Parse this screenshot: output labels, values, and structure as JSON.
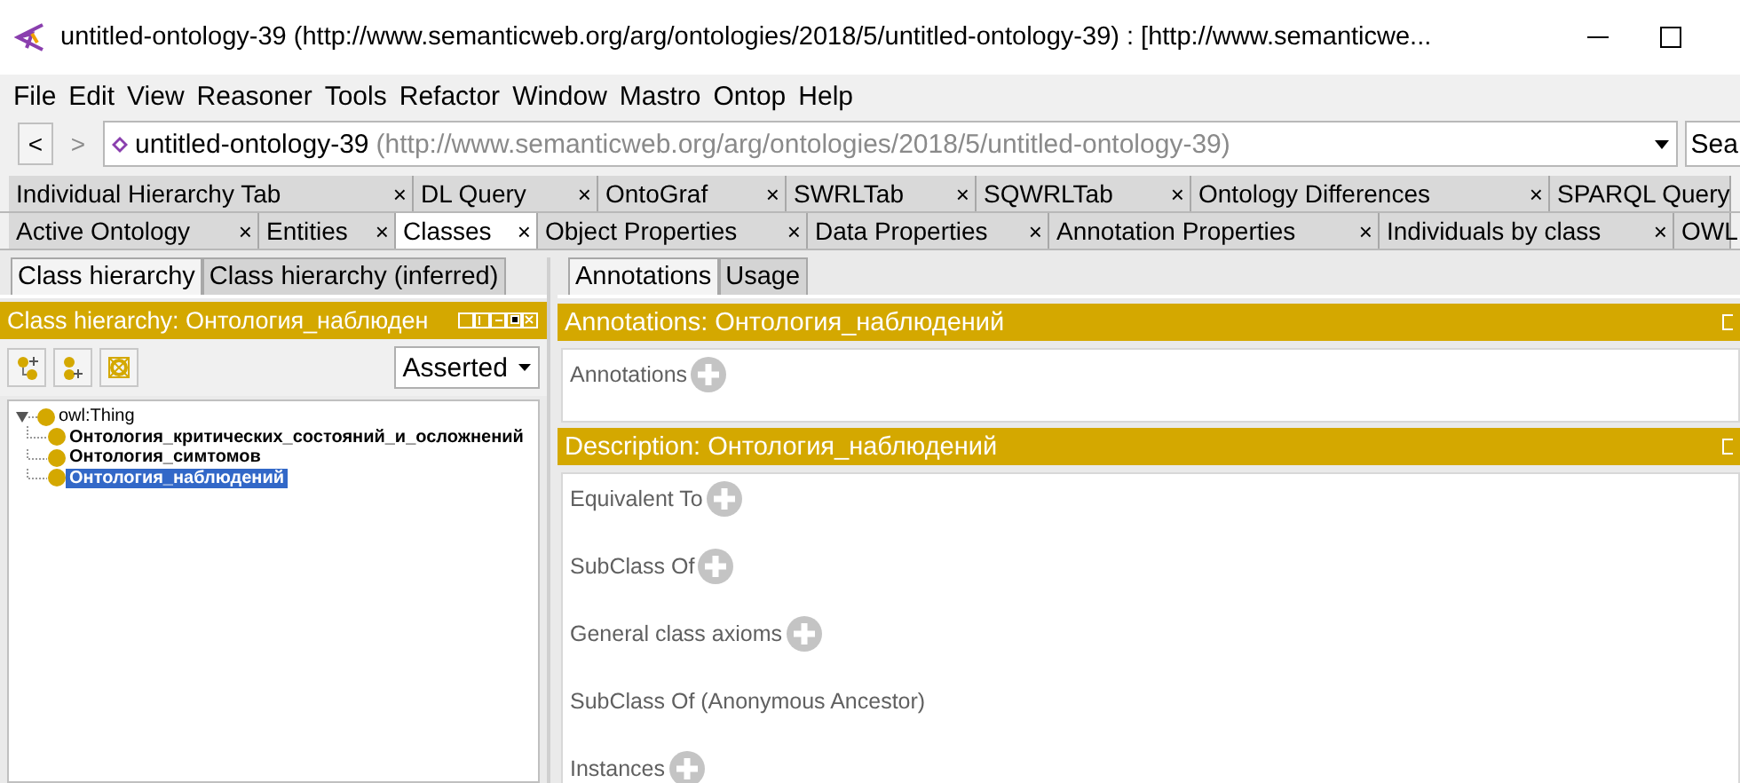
{
  "window": {
    "title": "untitled-ontology-39 (http://www.semanticweb.org/arg/ontologies/2018/5/untitled-ontology-39)  : [http://www.semanticwe..."
  },
  "menu": [
    "File",
    "Edit",
    "View",
    "Reasoner",
    "Tools",
    "Refactor",
    "Window",
    "Mastro",
    "Ontop",
    "Help"
  ],
  "nav_buttons": [
    {
      "label": "<",
      "disabled": false
    },
    {
      "label": ">",
      "disabled": true
    }
  ],
  "address": {
    "name": "untitled-ontology-39",
    "iri": "(http://www.semanticweb.org/arg/ontologies/2018/5/untitled-ontology-39)",
    "search": "Sea"
  },
  "tab_rows": [
    [
      {
        "label": "Individual Hierarchy Tab",
        "selected": false,
        "close": "×"
      },
      {
        "label": "DL Query",
        "selected": false,
        "close": "×"
      },
      {
        "label": "OntoGraf",
        "selected": false,
        "close": "×"
      },
      {
        "label": "SWRLTab",
        "selected": false,
        "close": "×"
      },
      {
        "label": "SQWRLTab",
        "selected": false,
        "close": "×"
      },
      {
        "label": "Ontology Differences",
        "selected": false,
        "close": "×"
      },
      {
        "label": "SPARQL Query",
        "selected": false
      }
    ],
    [
      {
        "label": "Active Ontology",
        "selected": false,
        "close": "×"
      },
      {
        "label": "Entities",
        "selected": false,
        "close": "×"
      },
      {
        "label": "Classes",
        "selected": true,
        "close": "×"
      },
      {
        "label": "Object Properties",
        "selected": false,
        "close": "×"
      },
      {
        "label": "Data Properties",
        "selected": false,
        "close": "×"
      },
      {
        "label": "Annotation Properties",
        "selected": false,
        "close": "×"
      },
      {
        "label": "Individuals by class",
        "selected": false,
        "close": "×"
      },
      {
        "label": "OWL",
        "selected": false
      }
    ]
  ],
  "class_panel": {
    "tabs": [
      {
        "label": "Class hierarchy",
        "selected": true
      },
      {
        "label": "Class hierarchy (inferred)",
        "selected": false
      }
    ],
    "header": "Class hierarchy: Онтология_наблюден",
    "mode": "Asserted",
    "tree": [
      {
        "label": "owl:Thing",
        "expanded": true,
        "selected": false,
        "children": [
          {
            "label": "Онтология_критических_состояний_и_осложнений",
            "selected": false
          },
          {
            "label": "Онтология_симтомов",
            "selected": false
          },
          {
            "label": "Онтология_наблюдений",
            "selected": true
          }
        ]
      }
    ]
  },
  "detail_panel": {
    "tabs": [
      {
        "label": "Annotations",
        "selected": true
      },
      {
        "label": "Usage",
        "selected": false
      }
    ],
    "sections": [
      {
        "header": "Annotations: Онтология_наблюдений",
        "fields": [
          {
            "label": "Annotations",
            "add": true
          }
        ]
      },
      {
        "header": "Description: Онтология_наблюдений",
        "fields": [
          {
            "label": "Equivalent To",
            "add": true
          },
          {
            "label": "SubClass Of",
            "add": true
          },
          {
            "label": "General class axioms",
            "add": true
          },
          {
            "label": "SubClass Of (Anonymous Ancestor)",
            "add": false
          },
          {
            "label": "Instances",
            "add": true
          }
        ]
      }
    ]
  }
}
